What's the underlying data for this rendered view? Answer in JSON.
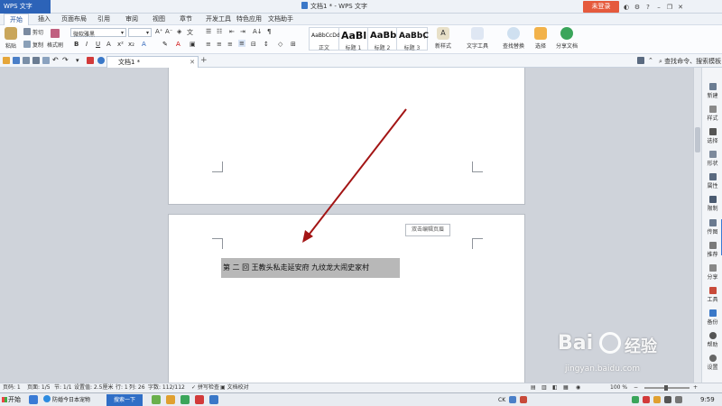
{
  "titlebar": {
    "app_name": "WPS 文字",
    "doc_title": "文档1 * - WPS 文字",
    "login": "未登录"
  },
  "menu": {
    "tabs": [
      "开始",
      "插入",
      "页面布局",
      "引用",
      "审阅",
      "视图",
      "章节",
      "开发工具",
      "特色应用",
      "文档助手"
    ],
    "active": "开始"
  },
  "ribbon": {
    "paste": "粘贴",
    "cut": "剪切",
    "copy": "复制",
    "format_painter": "格式刷",
    "font_name": "微软雅黑",
    "styles": [
      {
        "sample": "AaBbCcDd",
        "name": "正文"
      },
      {
        "sample": "AaBl",
        "name": "标题 1"
      },
      {
        "sample": "AaBb(",
        "name": "标题 2"
      },
      {
        "sample": "AaBbC",
        "name": "标题 3"
      }
    ],
    "new_style": "新样式",
    "text_tools": "文字工具",
    "find_replace": "查找替换",
    "select": "选择",
    "share_doc": "分享文档"
  },
  "quickbar": {
    "doc_tab": "文档1 *",
    "command_search": "查找命令、搜索模板"
  },
  "document": {
    "header_tip": "双击编辑页眉",
    "chapter_text": "第  二  回      王教头私走延安府    九纹龙大闹史家村"
  },
  "rightpane": {
    "items": [
      "新建",
      "样式",
      "选择",
      "形状",
      "属性",
      "限制",
      "传图",
      "推荐",
      "分享",
      "工具",
      "备份",
      "帮助",
      "设置"
    ]
  },
  "statusbar": {
    "page_no": "页码: 1",
    "page_count": "页面: 1/5",
    "section": "节: 1/1",
    "setting": "设置值: 2.5厘米",
    "row": "行: 1",
    "col": "列: 26",
    "word_count": "字数: 112/112",
    "spell_check": "拼写检查",
    "doc_proof": "文档校对",
    "zoom": "100 %"
  },
  "taskbar": {
    "start": "开始",
    "browser_item": "防婚今日本宠物",
    "search": "搜索一下",
    "clock": "9:59",
    "ime": "CK"
  },
  "watermark": {
    "brand": "Bai",
    "brand_cn": "经验",
    "url": "jingyan.baidu.com"
  },
  "colors": {
    "accent": "#2c63b8",
    "login": "#e55a3c",
    "arrow": "#a31515"
  }
}
